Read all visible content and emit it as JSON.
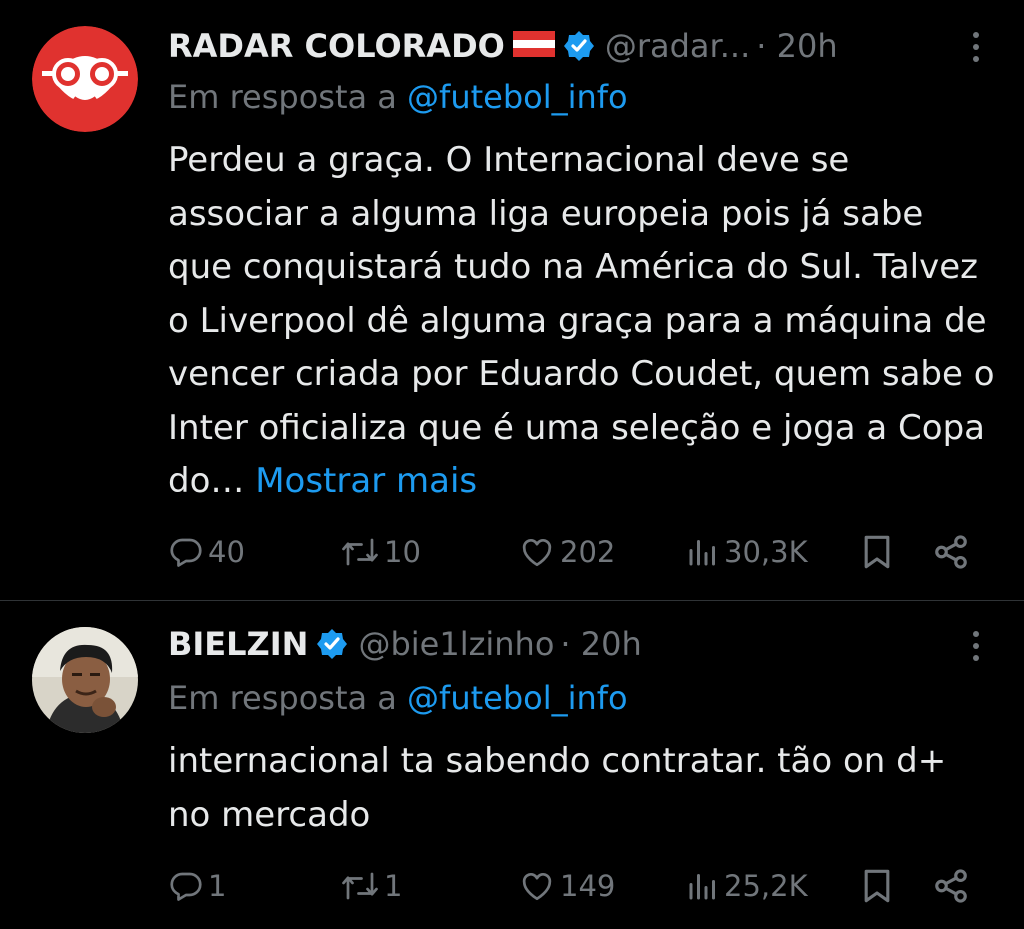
{
  "tweets": [
    {
      "display_name": "RADAR COLORADO",
      "handle": "@radar...",
      "time": "· 20h",
      "reply_prefix": "Em resposta a",
      "reply_to": "@futebol_info",
      "text": "Perdeu a graça. O Internacional deve se associar a alguma liga europeia pois já sabe que conquistará tudo na América do Sul. Talvez o Liverpool dê alguma graça para a máquina de vencer criada por Eduardo Coudet, quem sabe o Inter oficializa que é uma seleção e joga a Copa do…",
      "show_more": "Mostrar mais",
      "replies": "40",
      "retweets": "10",
      "likes": "202",
      "views": "30,3K"
    },
    {
      "display_name": "BIELZIN",
      "handle": "@bie1lzinho",
      "time": "· 20h",
      "reply_prefix": "Em resposta a",
      "reply_to": "@futebol_info",
      "text": "internacional ta sabendo contratar. tão on d+ no mercado",
      "replies": "1",
      "retweets": "1",
      "likes": "149",
      "views": "25,2K"
    }
  ],
  "colors": {
    "background": "#000000",
    "text": "#e7e9ea",
    "muted": "#71767b",
    "accent": "#1d9bf0",
    "divider": "#2f3336",
    "radar_red": "#e0322f"
  },
  "icons": [
    "reply-icon",
    "retweet-icon",
    "like-icon",
    "views-icon",
    "bookmark-icon",
    "share-icon",
    "verified-badge-icon",
    "more-icon",
    "austria-flag-icon"
  ]
}
